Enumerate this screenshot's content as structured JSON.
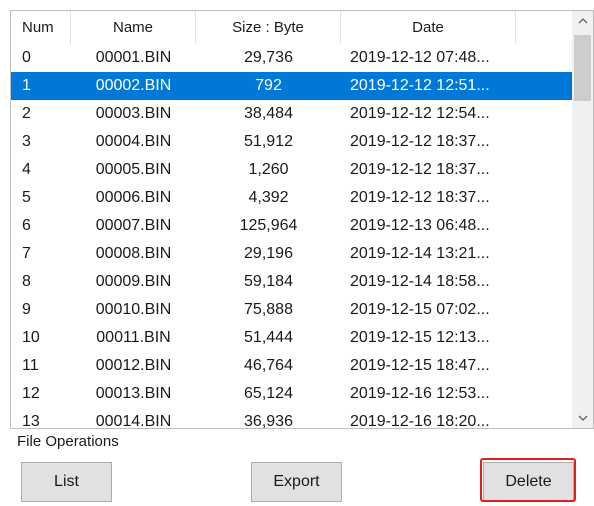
{
  "table": {
    "columns": [
      {
        "label": "Num"
      },
      {
        "label": "Name"
      },
      {
        "label": "Size : Byte"
      },
      {
        "label": "Date"
      }
    ],
    "selected_index": 1,
    "rows": [
      {
        "num": "0",
        "name": "00001.BIN",
        "size": "29,736",
        "date": "2019-12-12 07:48..."
      },
      {
        "num": "1",
        "name": "00002.BIN",
        "size": "792",
        "date": "2019-12-12 12:51..."
      },
      {
        "num": "2",
        "name": "00003.BIN",
        "size": "38,484",
        "date": "2019-12-12 12:54..."
      },
      {
        "num": "3",
        "name": "00004.BIN",
        "size": "51,912",
        "date": "2019-12-12 18:37..."
      },
      {
        "num": "4",
        "name": "00005.BIN",
        "size": "1,260",
        "date": "2019-12-12 18:37..."
      },
      {
        "num": "5",
        "name": "00006.BIN",
        "size": "4,392",
        "date": "2019-12-12 18:37..."
      },
      {
        "num": "6",
        "name": "00007.BIN",
        "size": "125,964",
        "date": "2019-12-13 06:48..."
      },
      {
        "num": "7",
        "name": "00008.BIN",
        "size": "29,196",
        "date": "2019-12-14 13:21..."
      },
      {
        "num": "8",
        "name": "00009.BIN",
        "size": "59,184",
        "date": "2019-12-14 18:58..."
      },
      {
        "num": "9",
        "name": "00010.BIN",
        "size": "75,888",
        "date": "2019-12-15 07:02..."
      },
      {
        "num": "10",
        "name": "00011.BIN",
        "size": "51,444",
        "date": "2019-12-15 12:13..."
      },
      {
        "num": "11",
        "name": "00012.BIN",
        "size": "46,764",
        "date": "2019-12-15 18:47..."
      },
      {
        "num": "12",
        "name": "00013.BIN",
        "size": "65,124",
        "date": "2019-12-16 12:53..."
      },
      {
        "num": "13",
        "name": "00014.BIN",
        "size": "36,936",
        "date": "2019-12-16 18:20..."
      }
    ]
  },
  "scrollbar": {
    "up_icon": "chevron-up-icon",
    "down_icon": "chevron-down-icon"
  },
  "file_operations": {
    "group_label": "File Operations",
    "list_label": "List",
    "export_label": "Export",
    "delete_label": "Delete"
  },
  "colors": {
    "selection": "#0078d7",
    "highlight_box": "#e01f1f",
    "button_face": "#e1e1e1"
  }
}
